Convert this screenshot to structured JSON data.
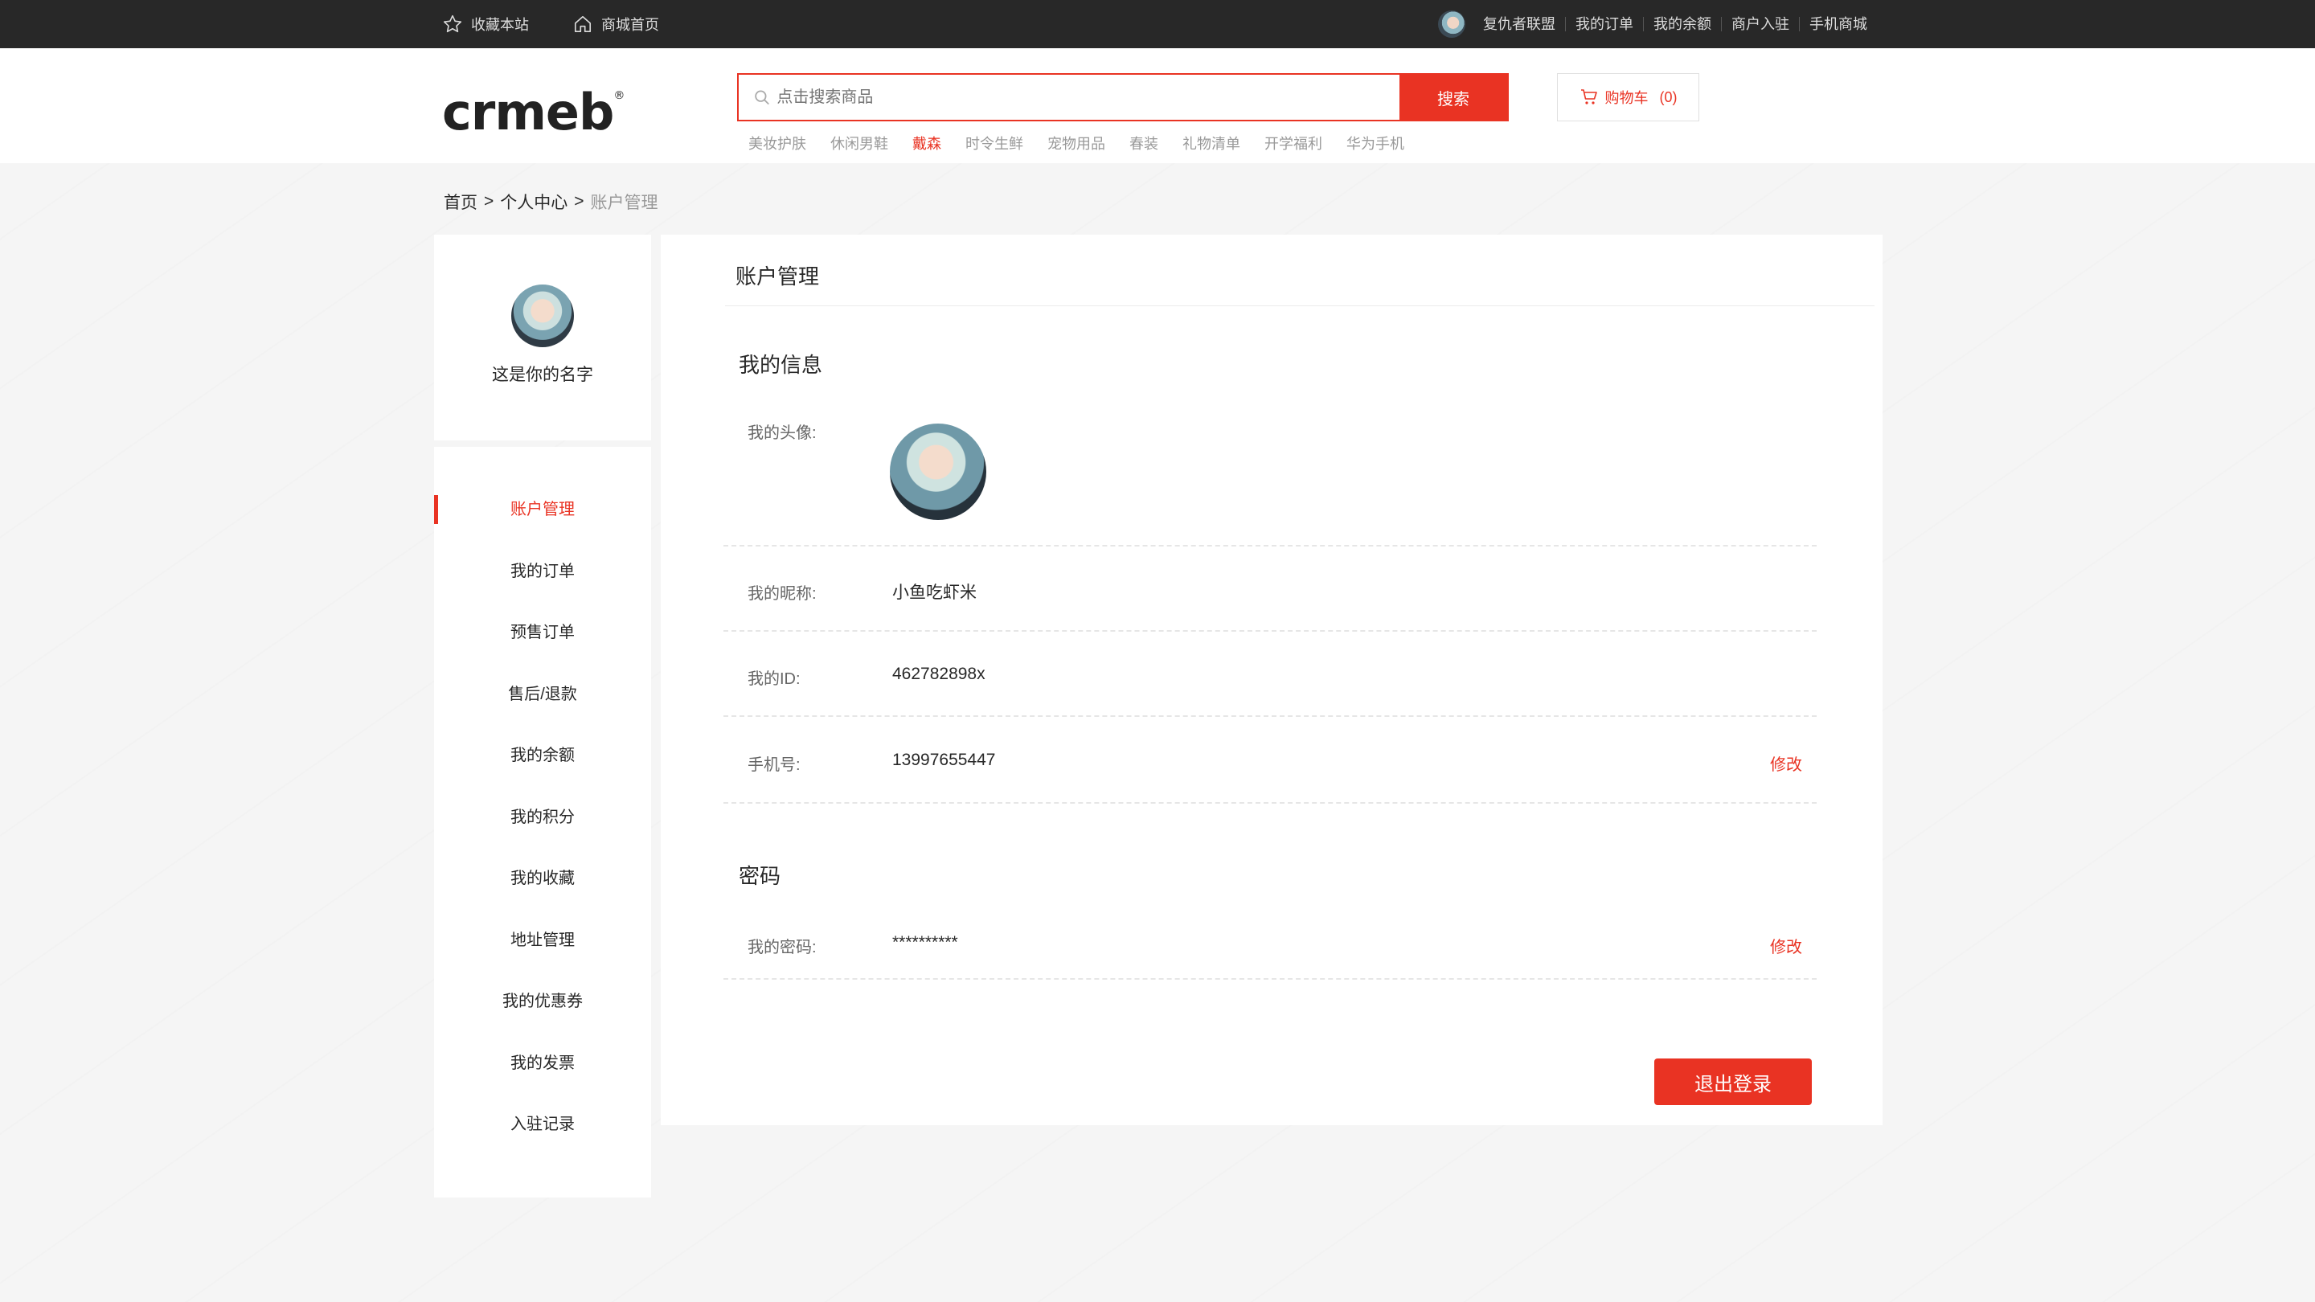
{
  "topbar": {
    "favorite": "收藏本站",
    "mall_home": "商城首页",
    "user_name": "复仇者联盟",
    "links": [
      "我的订单",
      "我的余额",
      "商户入驻",
      "手机商城"
    ]
  },
  "header": {
    "logo": "crmeb",
    "logo_mark": "®",
    "search_placeholder": "点击搜索商品",
    "search_button": "搜索",
    "hotwords": [
      "美妆护肤",
      "休闲男鞋",
      "戴森",
      "时令生鲜",
      "宠物用品",
      "春装",
      "礼物清单",
      "开学福利",
      "华为手机"
    ],
    "hotword_active_index": 2,
    "cart_label": "购物车",
    "cart_count": "(0)"
  },
  "breadcrumb": {
    "home": "首页",
    "center": "个人中心",
    "current": "账户管理",
    "sep": ">"
  },
  "profile": {
    "name": "这是你的名字"
  },
  "menu": {
    "items": [
      "账户管理",
      "我的订单",
      "预售订单",
      "售后/退款",
      "我的余额",
      "我的积分",
      "我的收藏",
      "地址管理",
      "我的优惠券",
      "我的发票",
      "入驻记录"
    ],
    "active_index": 0
  },
  "main": {
    "title": "账户管理",
    "info_section": "我的信息",
    "avatar_label": "我的头像:",
    "nickname_label": "我的昵称:",
    "nickname": "小鱼吃虾米",
    "id_label": "我的ID:",
    "id": "462782898x",
    "phone_label": "手机号:",
    "phone": "13997655447",
    "edit": "修改",
    "password_section": "密码",
    "password_label": "我的密码:",
    "password": "**********",
    "logout": "退出登录"
  },
  "colors": {
    "accent": "#e93323",
    "topbar": "#282828"
  }
}
